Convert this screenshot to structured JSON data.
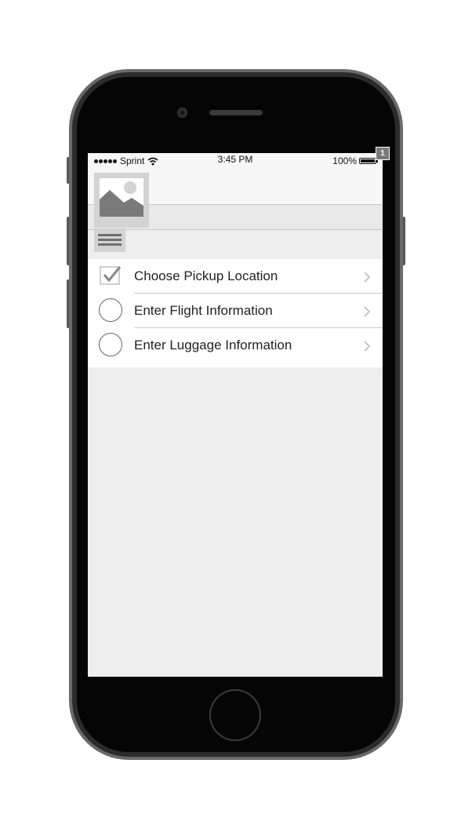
{
  "status_bar": {
    "carrier": "Sprint",
    "time": "3:45 PM",
    "battery_percent": "100%",
    "battery_level": 1.0,
    "wifi_icon": "wifi-icon",
    "signal_bars": 5
  },
  "header": {
    "image_placeholder_icon": "image-placeholder-icon"
  },
  "toolbar": {
    "menu_icon": "hamburger-menu-icon"
  },
  "steps": [
    {
      "label": "Choose Pickup Location",
      "status": "completed",
      "status_icon": "checkbox-checked-icon"
    },
    {
      "label": "Enter Flight Information",
      "status": "pending",
      "status_icon": "circle-outline-icon"
    },
    {
      "label": "Enter Luggage Information",
      "status": "pending",
      "status_icon": "circle-outline-icon"
    }
  ],
  "annotation": {
    "badge_number": "1"
  },
  "colors": {
    "screen_background": "#eeeeee",
    "list_background": "#ffffff",
    "placeholder_gray": "#d3d3d3",
    "phone_body": "#050505"
  }
}
